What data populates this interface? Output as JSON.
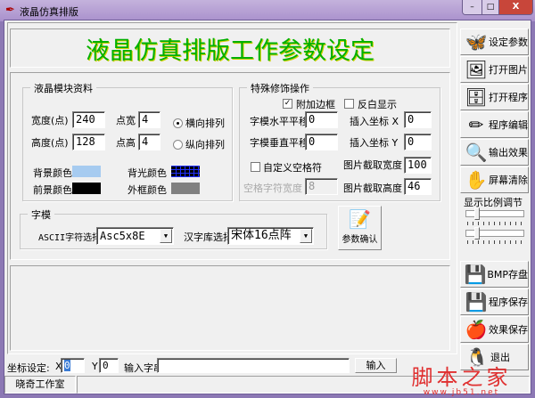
{
  "window": {
    "title": "液晶仿真排版",
    "btn_min": "–",
    "btn_max": "□",
    "btn_close": "X"
  },
  "header": {
    "title": "液晶仿真排版工作参数设定",
    "title_color": "#00b000"
  },
  "lcd_group": {
    "legend": "液晶模块资料",
    "width_label": "宽度(点)",
    "width_value": "240",
    "height_label": "高度(点)",
    "height_value": "128",
    "dot_w_label": "点宽",
    "dot_w_value": "4",
    "dot_h_label": "点高",
    "dot_h_value": "4",
    "radio_horizontal": "横向排列",
    "radio_vertical": "纵向排列",
    "bg_color_label": "背景颜色",
    "bg_color": "#a6cbf0",
    "fg_color_label": "前景颜色",
    "fg_color": "#000000",
    "backlight_label": "背光颜色",
    "backlight_color": "#000080",
    "frame_label": "外框颜色",
    "frame_color": "#808080"
  },
  "special_group": {
    "legend": "特殊修饰操作",
    "add_border": "附加边框",
    "invert": "反白显示",
    "h_shift_label": "字模水平平移",
    "h_shift": "0",
    "v_shift_label": "字模垂直平移",
    "v_shift": "0",
    "insert_x_label": "插入坐标 X",
    "insert_x": "0",
    "insert_y_label": "插入坐标 Y",
    "insert_y": "0",
    "custom_space": "自定义空格符",
    "space_width_label": "空格字符宽度",
    "space_width": "8",
    "crop_w_label": "图片截取宽度",
    "crop_w": "100",
    "crop_h_label": "图片截取高度",
    "crop_h": "46"
  },
  "font_group": {
    "legend": "字模",
    "ascii_label": "ASCII字符选择",
    "ascii_value": "Asc5x8E",
    "hz_label": "汉字库选择",
    "hz_value": "宋体16点阵"
  },
  "confirm_button": "参数确认",
  "toolbar": {
    "top": [
      {
        "label": "设定参数",
        "icon": "butterfly-icon",
        "glyph": "🦋"
      },
      {
        "label": "打开图片",
        "icon": "open-image-icon",
        "glyph": "🖼"
      },
      {
        "label": "打开程序",
        "icon": "file-cabinet-icon",
        "glyph": "🗄"
      },
      {
        "label": "程序编辑",
        "icon": "pencil-icon",
        "glyph": "✏"
      },
      {
        "label": "输出效果",
        "icon": "magnifier-icon",
        "glyph": "🔍"
      },
      {
        "label": "屏幕清除",
        "icon": "eraser-hand-icon",
        "glyph": "✋"
      }
    ],
    "scale_label": "显示比例调节",
    "bottom": [
      {
        "label": "BMP存盘",
        "icon": "disk-save-icon",
        "glyph": "💾"
      },
      {
        "label": "程序保存",
        "icon": "red-floppy-icon",
        "glyph": "💾"
      },
      {
        "label": "效果保存",
        "icon": "apple-floppy-icon",
        "glyph": "🍎"
      },
      {
        "label": "退出",
        "icon": "penguin-icon",
        "glyph": "🐧"
      }
    ]
  },
  "bottom_bar": {
    "coord_label": "坐标设定:",
    "x_label": "X",
    "x_value": "0",
    "y_label": "Y",
    "y_value": "0",
    "string_label": "输入字串",
    "string_value": "",
    "input_button": "输入"
  },
  "status": {
    "studio": "晓奇工作室"
  },
  "watermark": {
    "text": "脚本之家",
    "url": "www.jb51.net"
  }
}
